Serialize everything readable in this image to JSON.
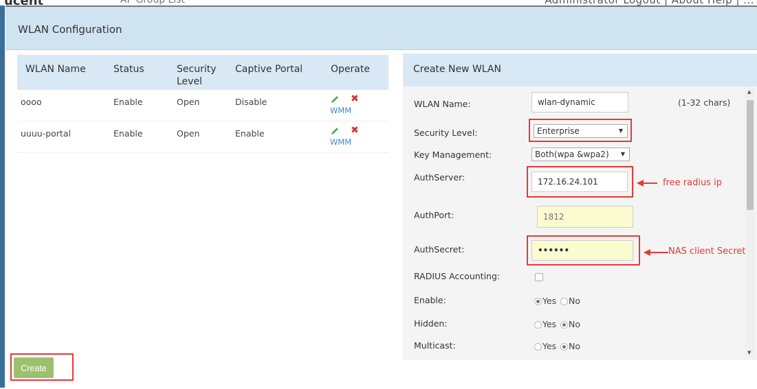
{
  "topbar": {
    "logo": "ucent",
    "group": "AP Group List",
    "links": "Administrator  Logout  |  About  Help  |  ..."
  },
  "dialog": {
    "title": "WLAN Configuration"
  },
  "wlan_table": {
    "columns": [
      "WLAN Name",
      "Status",
      "Security Level",
      "Captive Portal",
      "Operate"
    ],
    "rows": [
      {
        "name": "oooo",
        "status": "Enable",
        "security": "Open",
        "portal": "Disable",
        "wmm": "WMM"
      },
      {
        "name": "uuuu-portal",
        "status": "Enable",
        "security": "Open",
        "portal": "Enable",
        "wmm": "WMM"
      }
    ]
  },
  "create_panel": {
    "title": "Create New WLAN",
    "wlan_name_label": "WLAN Name:",
    "wlan_name_value": "wlan-dynamic",
    "wlan_name_hint": "(1-32 chars)",
    "security_label": "Security Level:",
    "security_value": "Enterprise",
    "keymgmt_label": "Key Management:",
    "keymgmt_value": "Both(wpa &wpa2)",
    "authserver_label": "AuthServer:",
    "authserver_value": "172.16.24.101",
    "authport_label": "AuthPort:",
    "authport_placeholder": "1812",
    "authsecret_label": "AuthSecret:",
    "authsecret_value": "••••••",
    "radius_label": "RADIUS Accounting:",
    "enable_label": "Enable:",
    "enable_value": "Yes",
    "hidden_label": "Hidden:",
    "hidden_value": "No",
    "multicast_label": "Multicast:",
    "multicast_value": "No",
    "yes_label": "Yes",
    "no_label": "No"
  },
  "annotations": {
    "authserver_note": "free radius ip",
    "authsecret_note": "NAS client Secret"
  },
  "actions": {
    "create_label": "Create"
  },
  "colors": {
    "header_bg": "#cfe3f1",
    "table_header_bg": "#d8e8f4",
    "annotation_red": "#e53935",
    "create_btn": "#9dc06f",
    "link_blue": "#3b8bc9"
  }
}
